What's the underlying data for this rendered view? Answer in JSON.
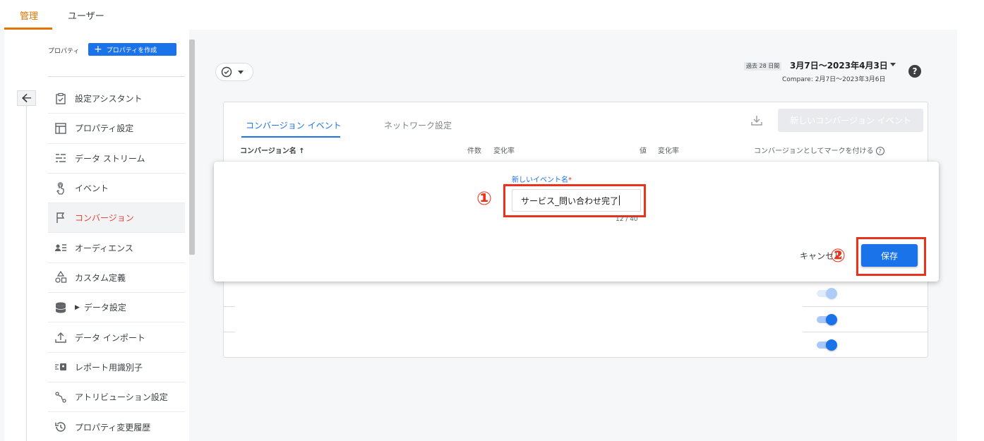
{
  "top_tabs": [
    {
      "label": "管理",
      "active": true
    },
    {
      "label": "ユーザー",
      "active": false
    }
  ],
  "property": {
    "label": "プロパティ",
    "create_button": "プロパティを作成"
  },
  "nav_items": [
    {
      "label": "設定アシスタント",
      "icon": "clipboard-check-icon",
      "active": false
    },
    {
      "label": "プロパティ設定",
      "icon": "layout-icon",
      "active": false
    },
    {
      "label": "データ ストリーム",
      "icon": "streams-icon",
      "active": false
    },
    {
      "label": "イベント",
      "icon": "touch-icon",
      "active": false
    },
    {
      "label": "コンバージョン",
      "icon": "flag-icon",
      "active": true
    },
    {
      "label": "オーディエンス",
      "icon": "audience-icon",
      "active": false
    },
    {
      "label": "カスタム定義",
      "icon": "shapes-icon",
      "active": false
    },
    {
      "label": "データ設定",
      "icon": "database-icon",
      "active": false,
      "expandable": true
    },
    {
      "label": "データ インポート",
      "icon": "upload-icon",
      "active": false
    },
    {
      "label": "レポート用識別子",
      "icon": "identity-icon",
      "active": false
    },
    {
      "label": "アトリビューション設定",
      "icon": "attribution-icon",
      "active": false
    },
    {
      "label": "プロパティ変更履歴",
      "icon": "history-icon",
      "active": false
    }
  ],
  "date": {
    "badge": "過去 28 日間",
    "range": "3月7日～2023年4月3日",
    "compare": "Compare: 2月7日～2023年3月6日"
  },
  "card": {
    "tabs": [
      {
        "label": "コンバージョン イベント",
        "active": true
      },
      {
        "label": "ネットワーク設定",
        "active": false
      }
    ],
    "new_button": "新しいコンバージョン イベント",
    "columns": {
      "name": "コンバージョン名 ↑",
      "count": "件数",
      "change1": "変化率",
      "value": "値",
      "change2": "変化率",
      "mark": "コンバージョンとしてマークを付ける"
    }
  },
  "dialog": {
    "field_label": "新しいイベント名",
    "required_mark": "*",
    "input_value": "サービス_問い合わせ完了",
    "counter": "12 / 40",
    "cancel": "キャンセル",
    "save": "保存",
    "step1": "①",
    "step2": "②"
  },
  "colors": {
    "accent": "#1a73e8",
    "active_tab": "#e37400",
    "highlight": "#e8341c"
  }
}
